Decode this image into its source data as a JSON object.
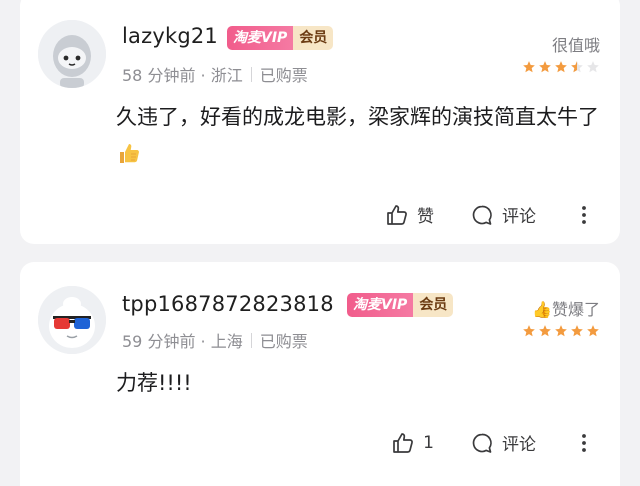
{
  "comments": [
    {
      "username": "lazykg21",
      "badge_vip": "淘麦VIP",
      "badge_member": "会员",
      "time": "58 分钟前 · 浙江",
      "purchase": "已购票",
      "rating_label": "很值哦",
      "rating_stars": 3.5,
      "text": "久违了，好看的成龙电影，梁家辉的演技简直太牛了",
      "text_emoji": "thumbs-up-emoji",
      "like_label": "赞",
      "comment_label": "评论"
    },
    {
      "username": "tpp1687872823818",
      "badge_vip": "淘麦VIP",
      "badge_member": "会员",
      "time": "59 分钟前 · 上海",
      "purchase": "已购票",
      "rating_label": "👍赞爆了",
      "rating_stars": 5,
      "text": "力荐!!!!",
      "like_count": "1",
      "comment_label": "评论"
    }
  ],
  "colors": {
    "star_fill": "#f39b3f",
    "star_empty": "#e6e6e8",
    "vip_badge": "#f15c8b",
    "member_badge": "#f7e6c6"
  }
}
